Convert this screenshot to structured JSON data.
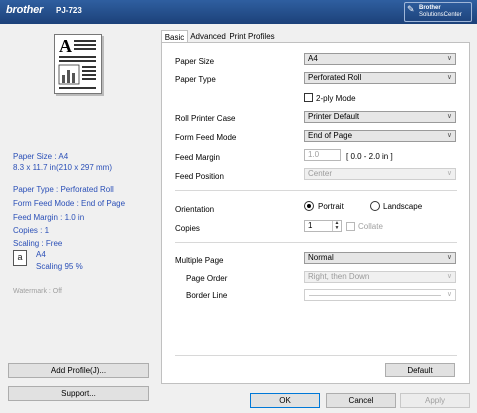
{
  "header": {
    "brand": "brother",
    "model": "PJ-723",
    "solutions_line1": "Brother",
    "solutions_line2": "SolutionsCenter",
    "colors": {
      "header": "#1c4179",
      "summary_text": "#2a4fb7"
    }
  },
  "summary": {
    "paper_size": "Paper Size : A4",
    "paper_dims": "8.3 x 11.7 in(210 x 297 mm)",
    "paper_type": "Paper Type : Perforated Roll",
    "form_feed_mode": "Form Feed Mode : End of Page",
    "feed_margin": "Feed Margin : 1.0 in",
    "copies": "Copies : 1",
    "scaling": "Scaling : Free",
    "scale_paper": "A4",
    "scale_percent": "Scaling 95 %",
    "watermark": "Watermark : Off",
    "scale_icon_letter": "a"
  },
  "preview": {
    "letter": "A"
  },
  "left_buttons": {
    "add_profile": "Add Profile(J)...",
    "support": "Support..."
  },
  "tabs": {
    "basic": "Basic",
    "advanced": "Advanced",
    "profiles": "Print Profiles"
  },
  "basic": {
    "paper_size_label": "Paper Size",
    "paper_size_value": "A4",
    "paper_type_label": "Paper Type",
    "paper_type_value": "Perforated Roll",
    "two_ply_label": "2-ply Mode",
    "roll_case_label": "Roll Printer Case",
    "roll_case_value": "Printer Default",
    "form_feed_label": "Form Feed Mode",
    "form_feed_value": "End of Page",
    "feed_margin_label": "Feed Margin",
    "feed_margin_value": "1.0",
    "feed_margin_range": "[ 0.0 - 2.0 in ]",
    "feed_position_label": "Feed Position",
    "feed_position_value": "Center",
    "orientation_label": "Orientation",
    "portrait_label": "Portrait",
    "landscape_label": "Landscape",
    "copies_label": "Copies",
    "copies_value": "1",
    "collate_label": "Collate",
    "multiple_page_label": "Multiple Page",
    "multiple_page_value": "Normal",
    "page_order_label": "Page Order",
    "page_order_value": "Right, then Down",
    "border_line_label": "Border Line",
    "border_line_value": "",
    "default_button": "Default"
  },
  "dialog_buttons": {
    "ok": "OK",
    "cancel": "Cancel",
    "apply": "Apply"
  },
  "icons": {
    "chevron": "∨",
    "spin_up": "▲",
    "spin_down": "▼",
    "bsc_icon": "✎"
  }
}
